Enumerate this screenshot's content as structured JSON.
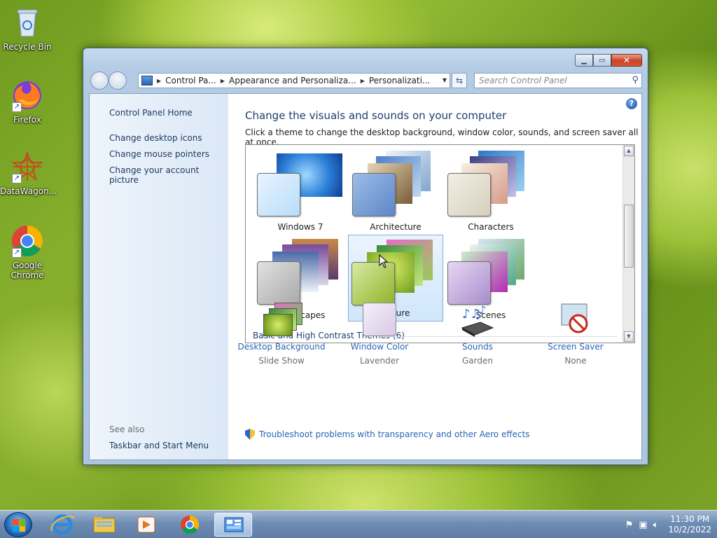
{
  "desktop": {
    "icons": [
      {
        "label": "Recycle Bin",
        "icon": "recycle-bin-icon"
      },
      {
        "label": "Firefox",
        "icon": "firefox-icon"
      },
      {
        "label": "DataWagon...",
        "icon": "datawagon-icon"
      },
      {
        "label": "Google Chrome",
        "icon": "chrome-icon"
      }
    ]
  },
  "window": {
    "address": {
      "segments": [
        "Control Pa...",
        "Appearance and Personaliza...",
        "Personalizati..."
      ]
    },
    "search": {
      "placeholder": "Search Control Panel"
    },
    "left_pane": {
      "home": "Control Panel Home",
      "links": [
        "Change desktop icons",
        "Change mouse pointers",
        "Change your account picture"
      ],
      "see_also_label": "See also",
      "see_also_links": [
        "Taskbar and Start Menu"
      ]
    },
    "main": {
      "title": "Change the visuals and sounds on your computer",
      "subtitle": "Click a theme to change the desktop background, window color, sounds, and screen saver all at once.",
      "themes": [
        {
          "label": "Windows 7",
          "selected": false
        },
        {
          "label": "Architecture",
          "selected": false
        },
        {
          "label": "Characters",
          "selected": false
        },
        {
          "label": "Landscapes",
          "selected": false
        },
        {
          "label": "Nature",
          "selected": true
        },
        {
          "label": "Scenes",
          "selected": false
        }
      ],
      "group_title": "Basic and High Contrast Themes (6)",
      "bottom": [
        {
          "link": "Desktop Background",
          "value": "Slide Show",
          "icon": "desktop-background-icon"
        },
        {
          "link": "Window Color",
          "value": "Lavender",
          "icon": "window-color-icon"
        },
        {
          "link": "Sounds",
          "value": "Garden",
          "icon": "sounds-icon"
        },
        {
          "link": "Screen Saver",
          "value": "None",
          "icon": "screen-saver-icon"
        }
      ],
      "aero_link": "Troubleshoot problems with transparency and other Aero effects"
    }
  },
  "taskbar": {
    "items": [
      "internet-explorer-icon",
      "file-explorer-icon",
      "media-player-icon",
      "chrome-icon",
      "control-panel-icon"
    ],
    "active_index": 4,
    "clock": {
      "time": "11:30 PM",
      "date": "10/2/2022"
    }
  },
  "colors": {
    "link": "#2766b8",
    "title": "#1e3d6e",
    "selection": "#cfe6fb"
  }
}
